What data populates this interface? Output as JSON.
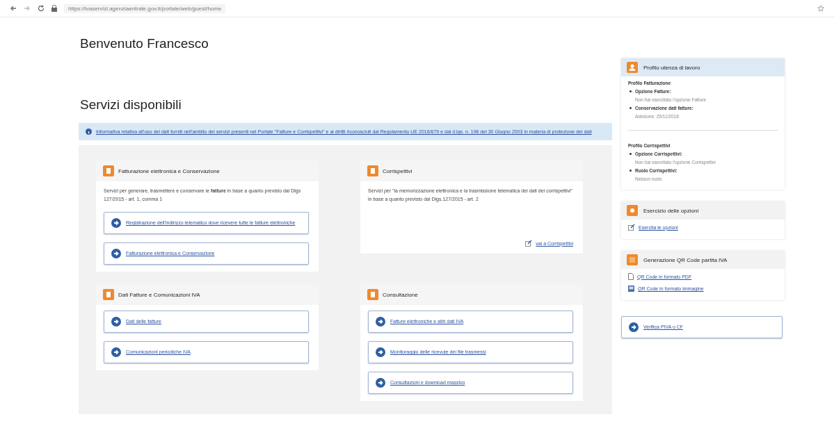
{
  "browser": {
    "url": "https://ivaservizi.agenziaentrate.gov.it/portale/web/guest/home"
  },
  "welcome": "Benvenuto  Francesco",
  "section_title": "Servizi disponibili",
  "notice": "Informativa relativa all'uso dei dati forniti nell'ambito dei servizi presenti nel Portale \"Fatture e Corrispettivi\" e ai diritti riconosciuti dal Regolamento UE 2016/679 e dal d.lgs. n. 196 del 30 Giugno 2003 in materia di protezione dei dati",
  "cards": [
    {
      "title": "Fatturazione elettronica e Conservazione",
      "text": "Servizi per generare, trasmettere e conservare le **fatture** in base a quanto previsto dal Dlgs 127/2015 - art. 1, comma 1",
      "links": [
        "Registrazione dell'indirizzo telematico dove ricevere tutte le fatture elettroniche",
        "Fatturazione elettronica e Conservazione"
      ]
    },
    {
      "title": "Corrispettivi",
      "text": "Servizi per \"la memorizzazione elettronica e la trasmissione telematica dei dati dei corrispettivi\" in base a quanto previsto dal Dlgs.127/2015 - art. 2",
      "footer_link": "vai a Corrispettivi"
    },
    {
      "title": "Dati Fatture e Comunicazioni IVA",
      "links": [
        "Dati delle fatture",
        "Comunicazioni periodiche IVA"
      ]
    },
    {
      "title": "Consultazione",
      "links": [
        "Fatture elettroniche e altri dati IVA",
        "Monitoraggio delle ricevute dei file trasmessi",
        "Consultazioni e download massivo"
      ]
    }
  ],
  "sidebar": {
    "profile": {
      "title": "Profilo utenza di lavoro",
      "groups": [
        {
          "heading": "Profilo Fatturazione",
          "items": [
            {
              "label": "Opzione Fatture:",
              "value": "Non hai esercitato l'opzione Fatture"
            },
            {
              "label": "Conservazione dati fatture:",
              "value": "Adesione: 25/11/2018"
            }
          ]
        },
        {
          "heading": "Profilo Corrispettivi",
          "items": [
            {
              "label": "Opzione Corrispettivi:",
              "value": "Non hai esercitato l'opzione Corrispettivi"
            },
            {
              "label": "Ruolo Corrispettivi:",
              "value": "Nessun ruolo"
            }
          ]
        }
      ]
    },
    "options": {
      "title": "Esercizio delle opzioni",
      "links": [
        {
          "kind": "edit",
          "label": "Esercita le opzioni"
        }
      ]
    },
    "qr": {
      "title": "Generazione QR Code partita IVA",
      "links": [
        {
          "kind": "pdf",
          "label": "QR Code in formato PDF"
        },
        {
          "kind": "image",
          "label": "QR Code in formato immagine"
        }
      ]
    },
    "verify": "Verifica PIVA o CF"
  }
}
